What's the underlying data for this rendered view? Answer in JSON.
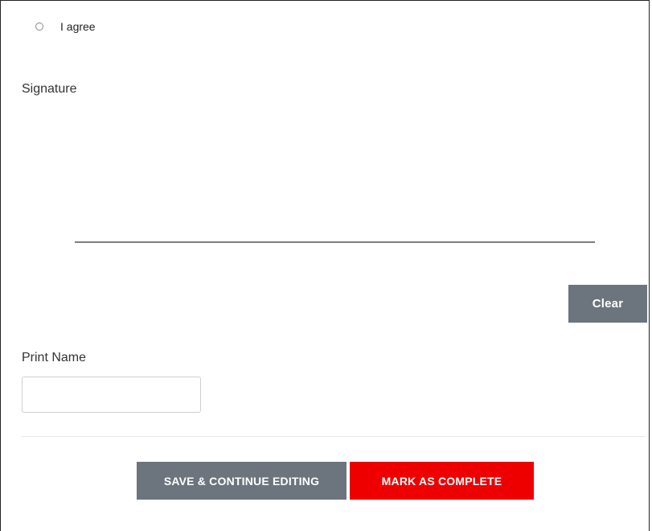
{
  "consent": {
    "agree_label": "I agree",
    "agree_checked": false
  },
  "signature": {
    "label": "Signature",
    "clear_label": "Clear"
  },
  "print_name": {
    "label": "Print Name",
    "value": "",
    "placeholder": ""
  },
  "actions": {
    "save_label": "SAVE & CONTINUE EDITING",
    "complete_label": "MARK AS COMPLETE"
  },
  "colors": {
    "secondary_button": "#6c757d",
    "primary_button": "#ee0000",
    "signature_line": "#7d7d7d"
  }
}
